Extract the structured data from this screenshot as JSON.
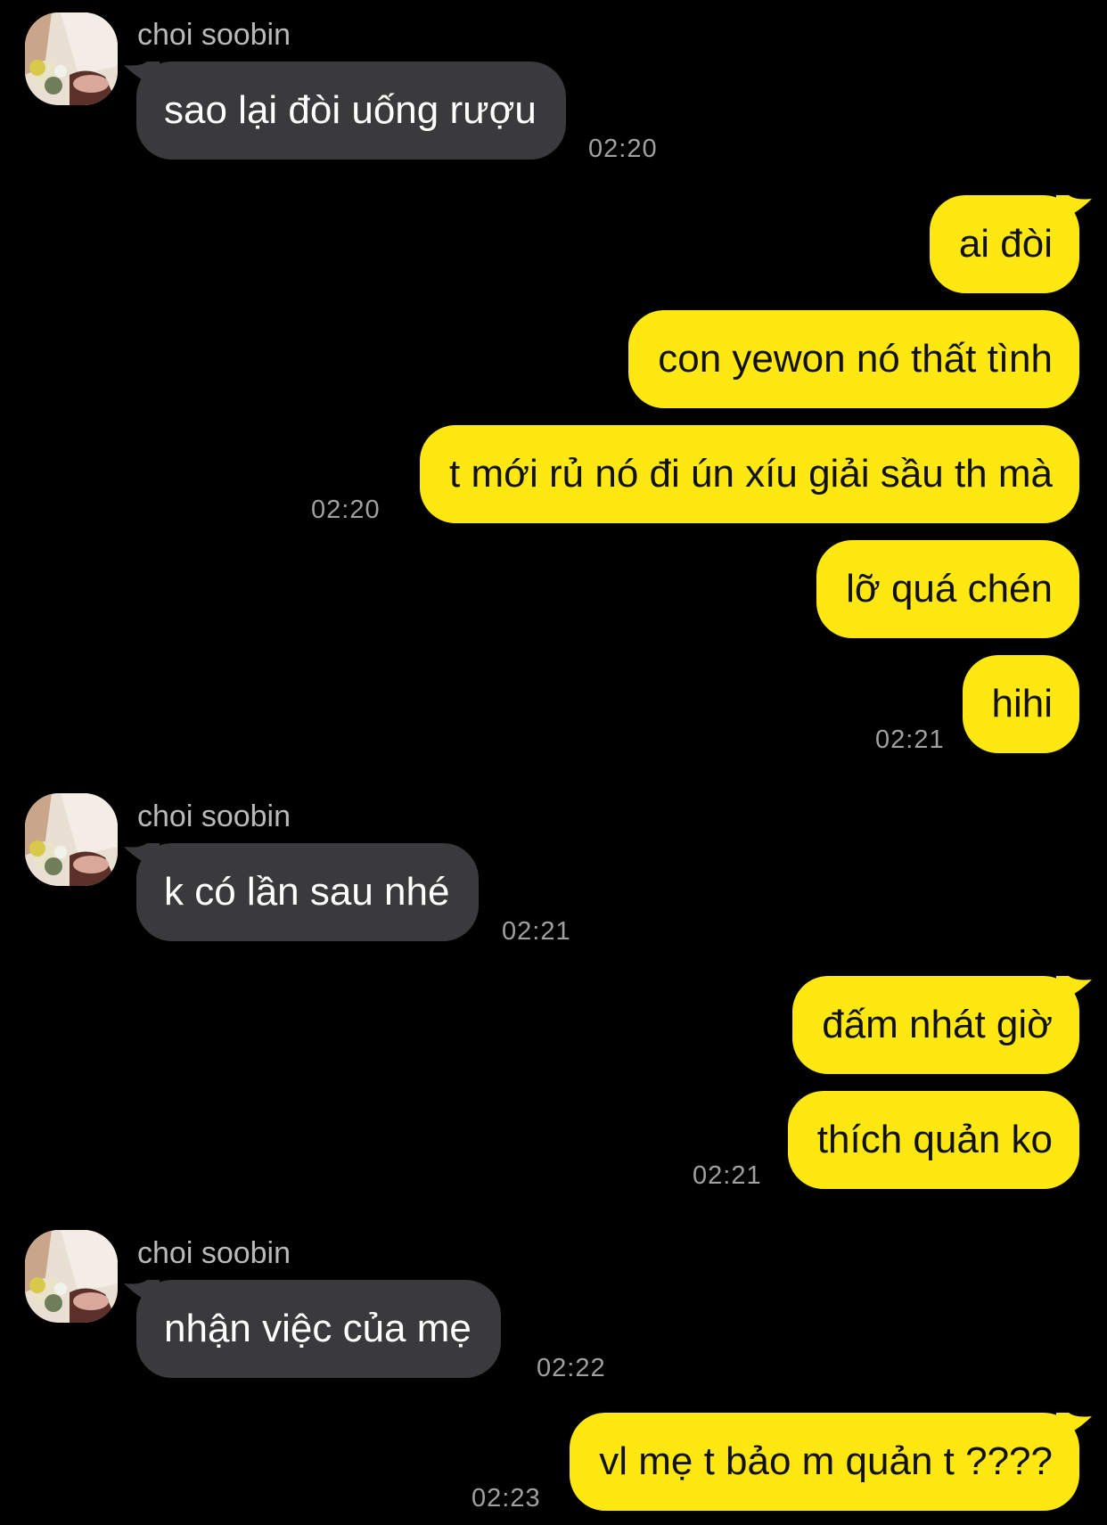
{
  "contact": {
    "name": "choi soobin"
  },
  "colors": {
    "background": "#000000",
    "incoming_bubble": "#3a3a3c",
    "outgoing_bubble": "#ffe812",
    "timestamp": "#a0a0a0"
  },
  "messages": [
    {
      "from": "other",
      "text": "sao lại đòi uống rượu",
      "time": "02:20"
    },
    {
      "from": "me",
      "text": "ai đòi"
    },
    {
      "from": "me",
      "text": "con yewon nó thất tình"
    },
    {
      "from": "me",
      "text": "t mới rủ nó đi ún xíu giải sầu th mà",
      "time": "02:20"
    },
    {
      "from": "me",
      "text": "lỡ quá chén"
    },
    {
      "from": "me",
      "text": "hihi",
      "time": "02:21"
    },
    {
      "from": "other",
      "text": "k có lần sau nhé",
      "time": "02:21"
    },
    {
      "from": "me",
      "text": "đấm nhát giờ"
    },
    {
      "from": "me",
      "text": "thích quản ko",
      "time": "02:21"
    },
    {
      "from": "other",
      "text": "nhận việc của mẹ",
      "time": "02:22"
    },
    {
      "from": "me",
      "text": "vl mẹ t bảo m quản t ????",
      "time": "02:23"
    }
  ]
}
